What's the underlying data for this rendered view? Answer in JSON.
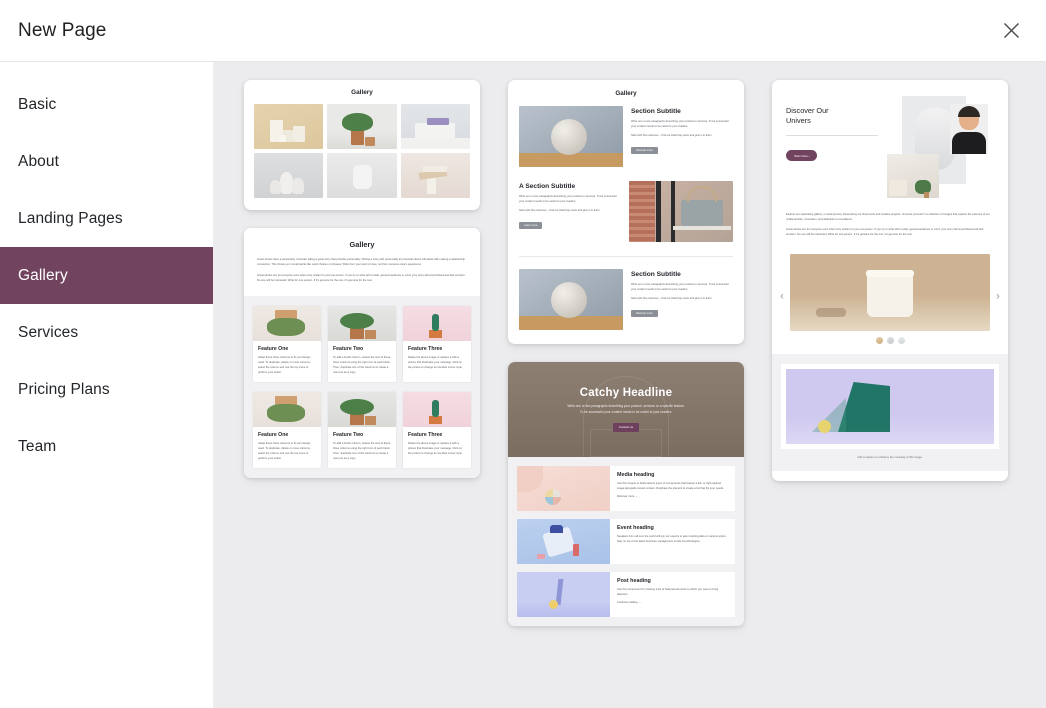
{
  "header": {
    "title": "New Page",
    "close_icon": "close-icon"
  },
  "sidebar": {
    "items": [
      {
        "label": "Basic",
        "active": false
      },
      {
        "label": "About",
        "active": false
      },
      {
        "label": "Landing Pages",
        "active": false
      },
      {
        "label": "Gallery",
        "active": true
      },
      {
        "label": "Services",
        "active": false
      },
      {
        "label": "Pricing Plans",
        "active": false
      },
      {
        "label": "Team",
        "active": false
      }
    ],
    "active_color": "#71435f"
  },
  "templates": {
    "gallery_grid": {
      "title": "Gallery"
    },
    "gallery_features": {
      "title": "Gallery",
      "intro_1": "Great stories have a personality. Consider telling a great story that provides personality. Writing a story with personality for potential clients will assist with making a relationship connection. This shows up in small quirks like word choices or phrases. Write from your point of view, not from someone else's experience.",
      "intro_2": "Great stories are for everyone even when only written for just one person. If you try to write with a wide, general audience in mind, your story will sound bland and lack emotion. No one will be interested. Write for one person. If it's genuine for the one, it's genuine for the rest.",
      "features": [
        {
          "title": "Feature One",
          "body": "Adapt these three columns to fit your design need. To duplicate, delete or move columns, select the column and use the top icons to perform your action."
        },
        {
          "title": "Feature Two",
          "body": "To add a fourth column, reduce the size of these three columns using the right icon of each block. Then, duplicate one of the columns to create a new one as a copy."
        },
        {
          "title": "Feature Three",
          "body": "Delete the above image or replace it with a picture that illustrates your message. Click on the picture to change its rounded corner style."
        }
      ]
    },
    "gallery_sections": {
      "title": "Gallery",
      "sections": [
        {
          "heading": "Section Subtitle",
          "body_1": "Write one or two paragraphs describing your product or services. To be successful your content needs to be useful to your readers.",
          "body_2": "Start with the customer – find out what they want and give it to them.",
          "button": "Discover more"
        },
        {
          "heading": "A Section Subtitle",
          "body_1": "Write one or two paragraphs describing your product or services. To be successful your content needs to be useful to your readers.",
          "body_2": "Start with the customer – find out what they want and give it to them.",
          "button": "Learn more"
        },
        {
          "heading": "Section Subtitle",
          "body_1": "Write one or two paragraphs describing your product or services. To be successful your content needs to be useful to your readers.",
          "body_2": "Start with the customer – find out what they want and give it to them.",
          "button": "Discover more"
        }
      ]
    },
    "catchy_headline": {
      "headline": "Catchy Headline",
      "sub_1": "Write one or two paragraphs describing your product, services or a specific feature.",
      "sub_2": "To be successful your content needs to be useful to your readers.",
      "cta": "Contact us",
      "rows": [
        {
          "title": "Media heading",
          "body": "Use this snippet to build various types of components that feature a left- or right-aligned image alongside textual content. Duplicate the element to create a list that fits your needs.",
          "link": "Discover more  →"
        },
        {
          "title": "Event heading",
          "body": "Speakers from all over the world will join our experts to give inspiring talks on various topics. Stay on top of the latest business management trends & technologies.",
          "link": ""
        },
        {
          "title": "Post heading",
          "body": "Use this component for creating a list of featured elements to which you want to bring attention.",
          "link": "Continue reading  →"
        }
      ]
    },
    "discover": {
      "heading_line_1": "Discover Our",
      "heading_line_2": "Univers",
      "cta": "Start Now  ›",
      "body_1": "Explore our captivating gallery, a visual journey showcasing our finest work and creative projects. Immerse yourself in a collection of images that capture the essence of our craftsmanship, innovation, and dedication to excellence.",
      "body_2": "Great stories are for everyone even when only written for just one person. If you try to write with a wide, general audience in mind, your story will sound bland and lack emotion. No one will be interested. Write for one person. If it's genuine for the one, it's genuine for the rest.",
      "prev_icon": "chevron-left-icon",
      "next_icon": "chevron-right-icon",
      "caption": "Add a caption to enhance the meaning of this image."
    }
  }
}
